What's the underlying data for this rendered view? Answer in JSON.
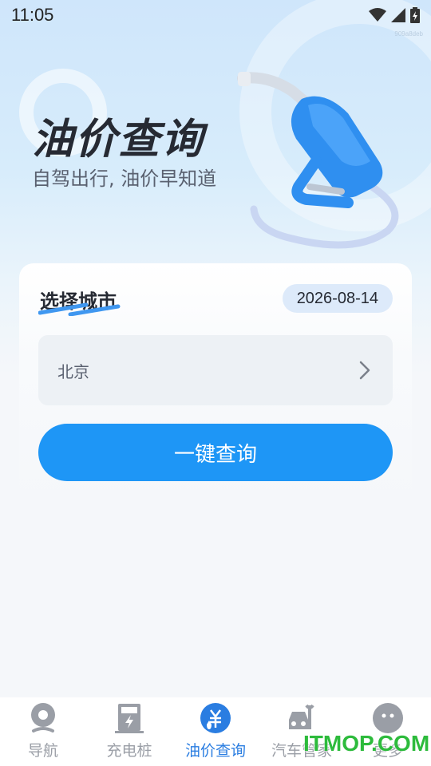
{
  "status_bar": {
    "time": "11:05",
    "icons": [
      "wifi-icon",
      "signal-icon",
      "battery-charging-icon"
    ]
  },
  "tiny_tag": "909a8deb",
  "hero": {
    "title": "油价查询",
    "subtitle": "自驾出行, 油价早知道",
    "illustration": "fuel-nozzle-icon"
  },
  "card": {
    "title": "选择城市",
    "date": "2026-08-14",
    "city_select": {
      "value": "北京",
      "icon": "chevron-right-icon"
    },
    "query_button_label": "一键查询"
  },
  "bottom_nav": {
    "items": [
      {
        "label": "导航",
        "icon": "map-pin-icon",
        "active": false
      },
      {
        "label": "充电桩",
        "icon": "charging-station-icon",
        "active": false
      },
      {
        "label": "油价查询",
        "icon": "fuel-price-icon",
        "active": true
      },
      {
        "label": "汽车管家",
        "icon": "car-tools-icon",
        "active": false
      },
      {
        "label": "更多",
        "icon": "more-face-icon",
        "active": false
      }
    ]
  },
  "watermark": "ITMOP.COM",
  "colors": {
    "accent": "#1e96f6",
    "active_nav": "#2a7de1",
    "inactive_nav": "#9a9ea6",
    "title_text": "#262a33"
  }
}
